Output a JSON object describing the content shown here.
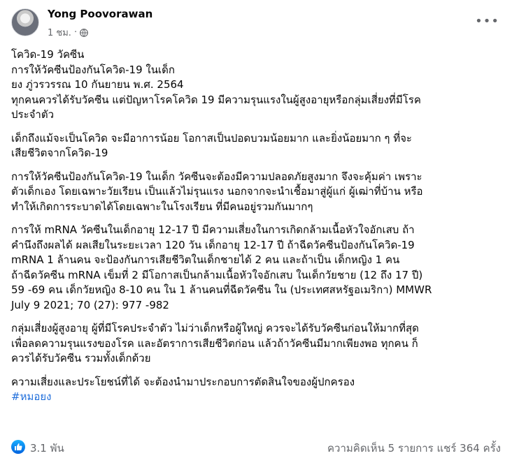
{
  "author": {
    "name": "Yong Poovorawan",
    "time": "1 ชม.",
    "dot": "·"
  },
  "post": {
    "p1": [
      "โควิด-19 วัคซีน",
      "การให้วัคซีนป้องกันโควิด-19 ในเด็ก",
      "ยง  ภู่วรวรรณ   10 กันยายน พ.ศ. 2564",
      "ทุกคนควรได้รับวัคซีน แต่ปัญหาโรคโควิด 19 มีความรุนแรงในผู้สูงอายุหรือกลุ่มเสี่ยงที่มีโรค",
      "ประจำตัว"
    ],
    "p2": [
      "เด็กถึงแม้จะเป็นโควิด จะมีอาการน้อย โอกาสเป็นปอดบวมน้อยมาก และยิ่งน้อยมาก ๆ ที่จะ",
      "เสียชีวิตจากโควิด-19"
    ],
    "p3": [
      "การให้วัคซีนป้องกันโควิด-19 ในเด็ก วัคซีนจะต้องมีความปลอดภัยสูงมาก จึงจะคุ้มค่า เพราะ",
      "ตัวเด็กเอง โดยเฉพาะวัยเรียน เป็นแล้วไม่รุนแรง นอกจากจะนำเชื้อมาสู่ผู้แก่ ผู้เฒ่าที่บ้าน หรือ",
      "ทำให้เกิดการระบาดได้โดยเฉพาะในโรงเรียน ที่มีคนอยู่รวมกันมากๆ"
    ],
    "p4": [
      "การให้  mRNA  วัคซีนในเด็กอายุ 12-17 ปี มีความเสี่ยงในการเกิดกล้ามเนื้อหัวใจอักเสบ ถ้า",
      "คำนึงถึงผลได้ ผลเสียในระยะเวลา 120 วัน เด็กอายุ 12-17 ปี ถ้าฉีดวัคซีนป้องกันโควิด-19",
      "mRNA 1 ล้านคน จะป้องกันการเสียชีวิตในเด็กชายได้  2 คน และถ้าเป็น เด็กหญิง 1 คน",
      "ถ้าฉีดวัคซีน  mRNA  เข็มที่ 2 มีโอกาสเป็นกล้ามเนื้อหัวใจอักเสบ ในเด็กวัยชาย (12 ถึง 17 ปี)",
      "59 -69 คน เด็กวัยหญิง 8-10 คน ใน 1 ล้านคนที่ฉีดวัคซีน ใน (ประเทศสหรัฐอเมริกา) MMWR",
      "July 9 2021; 70 (27): 977 -982"
    ],
    "p5": [
      "กลุ่มเสี่ยงผู้สูงอายุ ผู้ที่มีโรคประจำตัว ไม่ว่าเด็กหรือผู้ใหญ่ ควรจะได้รับวัคซีนก่อนให้มากที่สุด",
      "เพื่อลดความรุนแรงของโรค และอัตราการเสียชีวิตก่อน แล้วถ้าวัคซีนมีมากเพียงพอ ทุกคน ก็",
      "ควรได้รับวัคซีน รวมทั้งเด็กด้วย"
    ],
    "p6": [
      "ความเสี่ยงและประโยชน์ที่ได้ จะต้องนำมาประกอบการตัดสินใจของผู้ปกครอง"
    ],
    "hashtag": "#หมอยง"
  },
  "footer": {
    "reactions": "3.1 พัน",
    "stats": "ความคิดเห็น 5 รายการ  แชร์ 364 ครั้ง"
  },
  "colors": {
    "link": "#216fdb",
    "like": "#1877f2",
    "muted": "#65676b"
  },
  "icons": [
    "globe-icon",
    "more-options-icon",
    "like-reaction-icon"
  ]
}
